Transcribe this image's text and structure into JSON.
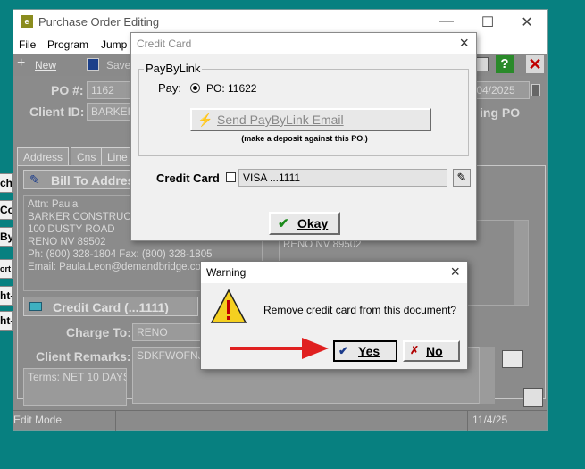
{
  "app": {
    "title": "Purchase Order Editing",
    "icon_letter": "e"
  },
  "menu": [
    "File",
    "Program",
    "Jump"
  ],
  "toolbar": {
    "new_label": "New",
    "save_label": "Save"
  },
  "left_buttons": [
    "ch",
    "Co",
    "By",
    "ort",
    "ht-",
    "ht-"
  ],
  "form": {
    "po_label": "PO #:",
    "po_value": "1162",
    "date_value": "/04/2025",
    "client_label": "Client ID:",
    "client_value": "BARKER",
    "po_side_text": "ing PO",
    "tabs": [
      "Address",
      "Cns",
      "Line"
    ],
    "bill_to_label": "Bill To Address",
    "address_lines": [
      "Attn: Paula",
      "BARKER CONSTRUCTI",
      "100 DUSTY ROAD",
      "RENO  NV    89502",
      "Ph: (800) 328-1804  Fax: (800) 328-1805",
      "Email: Paula.Leon@demandbridge.co"
    ],
    "ship_lines": [
      "",
      "RENO  NV    89502"
    ],
    "credit_card_bar": "Credit Card (...1111)",
    "charge_to_label": "Charge To:",
    "charge_to_value": "RENO",
    "remarks_label": "Client Remarks:",
    "remarks_value": "SDKFWOFNJDI",
    "terms": "Terms: NET 10 DAYS"
  },
  "status": {
    "mode": "Edit Mode",
    "date": "11/4/25"
  },
  "credit_dialog": {
    "title": "Credit Card",
    "group_label": "PayByLink",
    "pay_label": "Pay:",
    "pay_option": "PO: 11622",
    "send_button": "Send PayByLink Email",
    "send_note": "(make a deposit against this PO.)",
    "cc_label": "Credit Card",
    "cc_value": "VISA ...1111",
    "okay_button": "Okay"
  },
  "warning_dialog": {
    "title": "Warning",
    "message": "Remove credit card from this document?",
    "yes_button": "Yes",
    "no_button": "No"
  },
  "colors": {
    "desktop": "#078080",
    "disabled_grey": "#8b8b8b",
    "arrow": "#e02020"
  }
}
